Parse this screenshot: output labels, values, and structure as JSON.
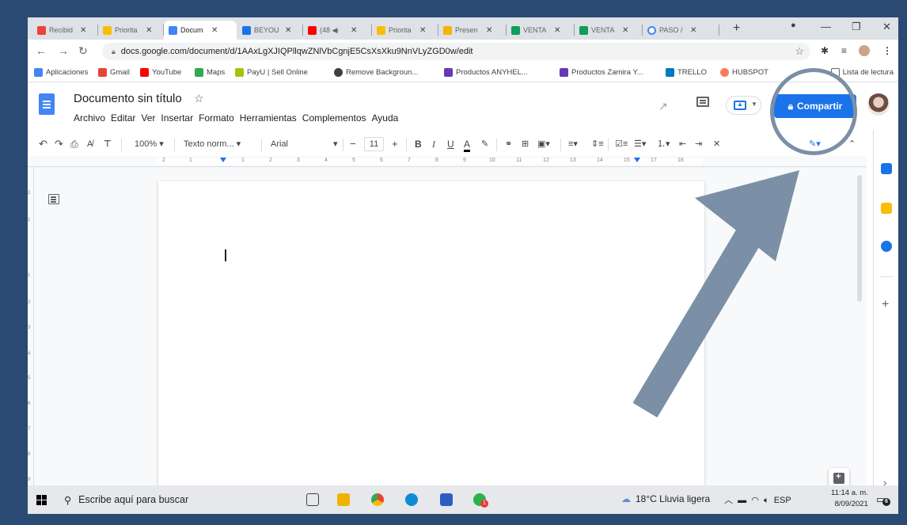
{
  "browser": {
    "tabs": [
      {
        "label": "Recibid",
        "color": "#ea4335"
      },
      {
        "label": "Priorita",
        "color": "#fbbc04"
      },
      {
        "label": "Docum",
        "color": "#4285f4",
        "active": true
      },
      {
        "label": "BEYOU",
        "color": "#1a73e8"
      },
      {
        "label": "(48 ◀·",
        "color": "#ff0000"
      },
      {
        "label": "Priorita",
        "color": "#fbbc04"
      },
      {
        "label": "Presen",
        "color": "#f4b400"
      },
      {
        "label": "VENTA",
        "color": "#0f9d58"
      },
      {
        "label": "VENTA",
        "color": "#0f9d58"
      },
      {
        "label": "PASO /",
        "color": "#4285f4"
      }
    ],
    "new_tab_label": "+",
    "url": "docs.google.com/document/d/1AAxLgXJIQPllqwZNlVbCgnjE5CsXsXku9NnVLyZGD0w/edit",
    "bookmarks": [
      {
        "label": "Aplicaciones",
        "color": "#4285f4"
      },
      {
        "label": "Gmail",
        "color": "#ea4335"
      },
      {
        "label": "YouTube",
        "color": "#ff0000"
      },
      {
        "label": "Maps",
        "color": "#34a853"
      },
      {
        "label": "PayU | Sell Online",
        "color": "#a6c307"
      },
      {
        "label": "Remove Backgroun...",
        "color": "#3c4043"
      },
      {
        "label": "Productos ANYHEL...",
        "color": "#673ab7"
      },
      {
        "label": "Productos Zamira Y...",
        "color": "#673ab7"
      },
      {
        "label": "TRELLO",
        "color": "#0079bf"
      },
      {
        "label": "HUBSPOT",
        "color": "#ff7a59"
      }
    ],
    "reading_list": "Lista de lectura"
  },
  "docs": {
    "title": "Documento sin título",
    "menus": [
      "Archivo",
      "Editar",
      "Ver",
      "Insertar",
      "Formato",
      "Herramientas",
      "Complementos",
      "Ayuda"
    ],
    "share_label": "Compartir",
    "zoom": "100%",
    "style": "Texto norm...",
    "font": "Arial",
    "font_size": "11",
    "ruler_ticks": [
      "2",
      "1",
      "1",
      "2",
      "3",
      "4",
      "5",
      "6",
      "7",
      "8",
      "9",
      "10",
      "11",
      "12",
      "13",
      "14",
      "15",
      "16",
      "17",
      "18"
    ],
    "vruler_ticks": [
      "2",
      "1",
      "1",
      "2",
      "3",
      "4",
      "5",
      "6",
      "7",
      "8",
      "9"
    ]
  },
  "taskbar": {
    "search_placeholder": "Escribe aquí para buscar",
    "weather": "18°C  Lluvia ligera",
    "language": "ESP",
    "time": "11:14 a. m.",
    "date": "8/09/2021",
    "notifications": "6",
    "chrome_badge": "1"
  },
  "colors": {
    "accent": "#1a73e8",
    "annotation": "#7b8fa6",
    "background": "#2a4a73"
  }
}
